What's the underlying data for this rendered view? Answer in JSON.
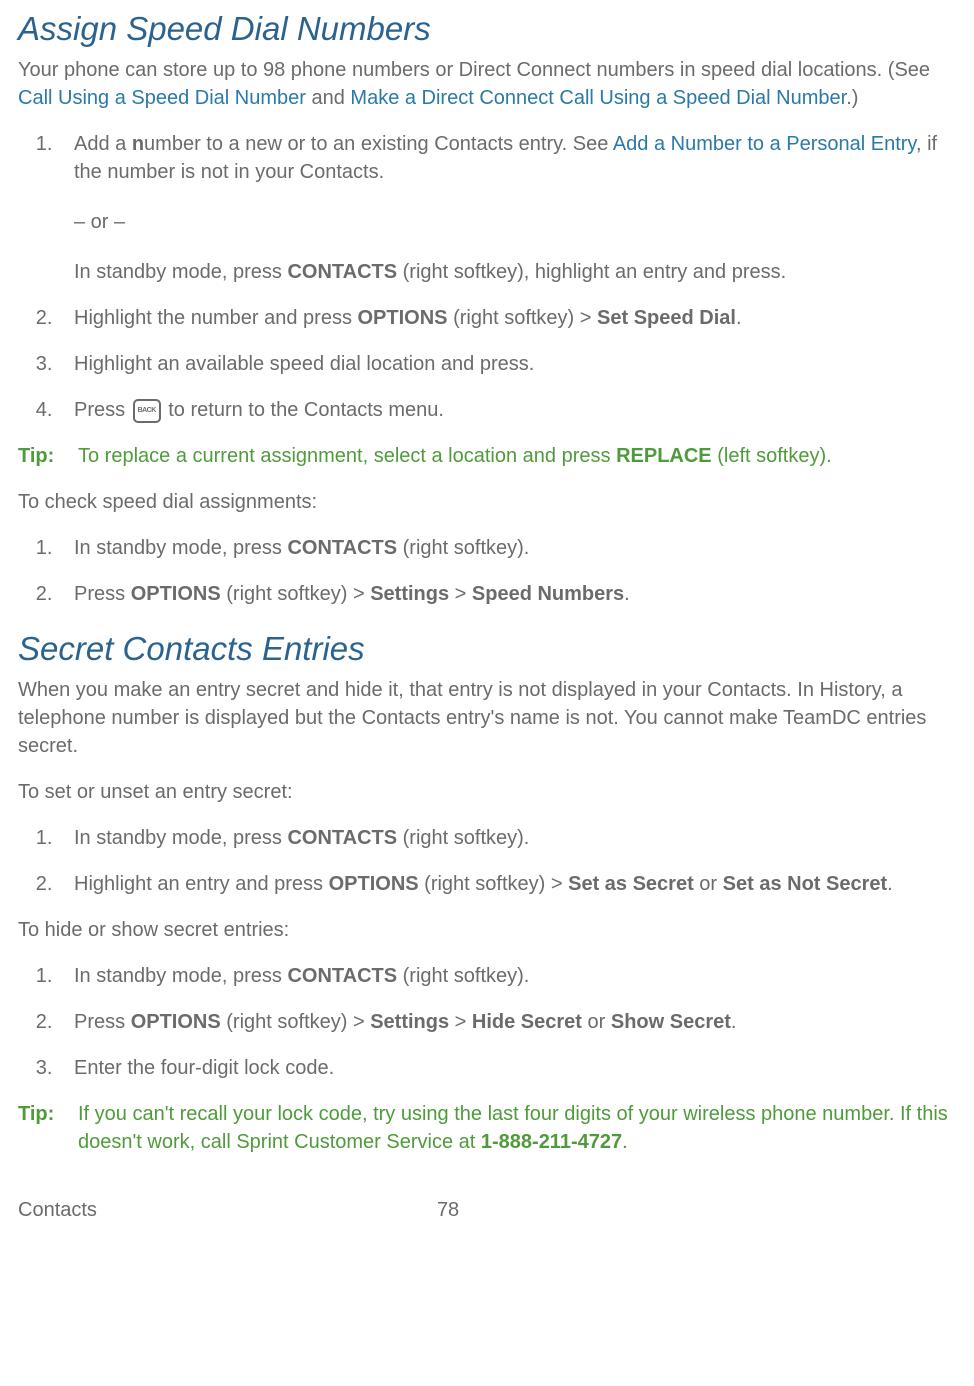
{
  "section1": {
    "title": "Assign Speed Dial Numbers",
    "intro_a": "Your phone can store up to 98 phone numbers or Direct Connect numbers in speed dial locations. (See ",
    "link1": "Call Using a Speed Dial Number",
    "intro_b": " and ",
    "link2": "Make a Direct Connect Call Using a Speed Dial Number",
    "intro_c": ".)",
    "step1_a": "Add a ",
    "step1_b": "n",
    "step1_c": "umber to a new or to an existing Contacts entry. See ",
    "step1_link": "Add a Number to a Personal Entry",
    "step1_d": ", if the number is not in your Contacts.",
    "step1_or": "– or –",
    "step1_alt_a": "In standby mode, press ",
    "step1_alt_b": "CONTACTS",
    "step1_alt_c": " (right softkey), highlight an entry and press.",
    "step2_a": "Highlight the number and press ",
    "step2_b": "OPTIONS",
    "step2_c": " (right softkey) > ",
    "step2_d": "Set Speed Dial",
    "step2_e": ".",
    "step3": "Highlight an available speed dial location and press.",
    "step4_a": "Press ",
    "step4_icon": "BACK",
    "step4_b": " to return to the Contacts menu.",
    "tip_label": "Tip:",
    "tip_a": "To replace a current assignment, select a location and press ",
    "tip_b": "REPLACE",
    "tip_c": " (left softkey).",
    "check_intro": "To check speed dial assignments:",
    "check1_a": "In standby mode, press ",
    "check1_b": "CONTACTS",
    "check1_c": " (right softkey).",
    "check2_a": "Press ",
    "check2_b": "OPTIONS",
    "check2_c": " (right softkey) > ",
    "check2_d": "Settings",
    "check2_e": " > ",
    "check2_f": "Speed Numbers",
    "check2_g": "."
  },
  "section2": {
    "title": "Secret Contacts Entries",
    "intro": "When you make an entry secret and hide it, that entry is not displayed in your Contacts. In History, a telephone number is displayed but the Contacts entry's name is not. You cannot make TeamDC entries secret.",
    "set_intro": "To set or unset an entry secret:",
    "set1_a": "In standby mode, press ",
    "set1_b": "CONTACTS",
    "set1_c": " (right softkey).",
    "set2_a": "Highlight an entry and press ",
    "set2_b": "OPTIONS",
    "set2_c": " (right softkey) > ",
    "set2_d": "Set as Secret",
    "set2_e": " or ",
    "set2_f": "Set as Not Secret",
    "set2_g": ".",
    "hide_intro": "To hide or show secret entries:",
    "hide1_a": "In standby mode, press ",
    "hide1_b": "CONTACTS",
    "hide1_c": " (right softkey).",
    "hide2_a": "Press ",
    "hide2_b": "OPTIONS",
    "hide2_c": " (right softkey) > ",
    "hide2_d": "Settings",
    "hide2_e": " > ",
    "hide2_f": "Hide Secret",
    "hide2_g": " or ",
    "hide2_h": "Show Secret",
    "hide2_i": ".",
    "hide3": "Enter the four-digit lock code.",
    "tip_label": "Tip:",
    "tip_a": "If you can't recall your lock code, try using the last four digits of your wireless phone number. If this doesn't work, call Sprint Customer Service at ",
    "tip_b": "1-888-211-4727",
    "tip_c": "."
  },
  "footer": {
    "chapter": "Contacts",
    "page": "78"
  }
}
